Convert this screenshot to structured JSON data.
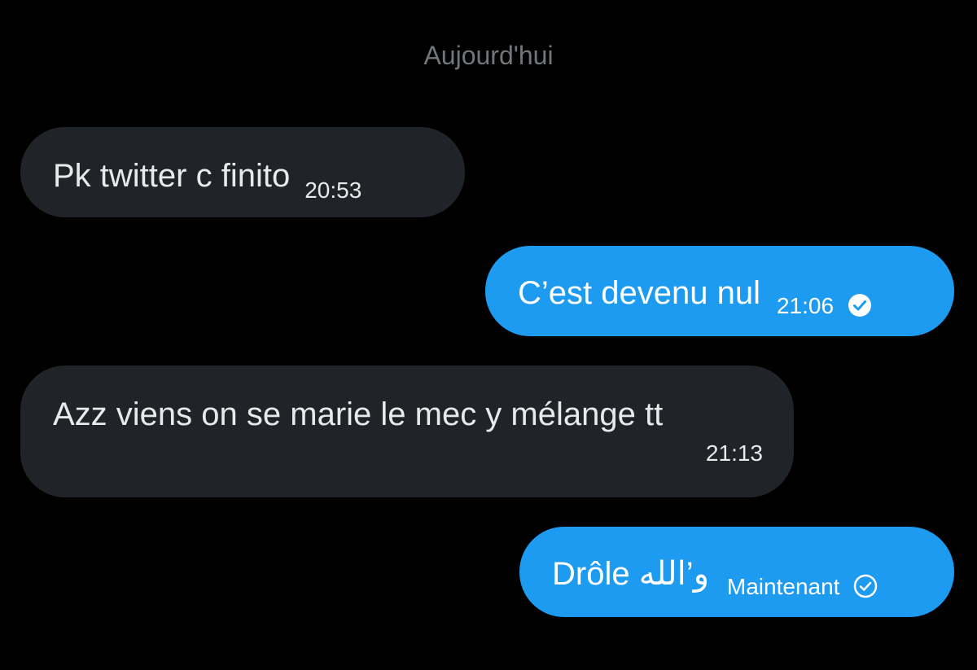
{
  "conversation": {
    "date_separator": "Aujourd'hui",
    "messages": [
      {
        "direction": "incoming",
        "text": "Pk twitter c finito",
        "time": "20:53"
      },
      {
        "direction": "outgoing",
        "text": "C’est devenu nul",
        "time": "21:06",
        "status": "read-check-filled"
      },
      {
        "direction": "incoming",
        "text": "Azz viens on se marie le mec y mélange tt",
        "time": "21:13"
      },
      {
        "direction": "outgoing",
        "text": "Drôle و’الله",
        "time": "Maintenant",
        "status": "sent-check-outline"
      }
    ]
  },
  "colors": {
    "background": "#000000",
    "incoming_bubble": "#202327",
    "outgoing_bubble": "#1d9bf0",
    "separator_text": "#71767b"
  }
}
